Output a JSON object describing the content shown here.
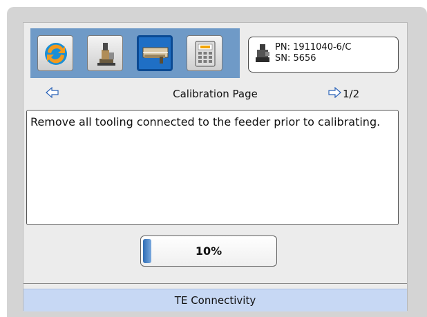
{
  "toolbar": {
    "buttons": [
      {
        "name": "refresh-icon",
        "active": false
      },
      {
        "name": "feeder-machine-icon",
        "active": false
      },
      {
        "name": "calibration-tool-icon",
        "active": true
      },
      {
        "name": "te-calculator-icon",
        "active": false
      }
    ]
  },
  "part_info": {
    "pn": "PN: 1911040-6/C",
    "sn": "SN: 5656",
    "icon": "applicator-icon"
  },
  "nav": {
    "prev_icon": "arrow-left-icon",
    "title": "Calibration Page",
    "next_icon": "arrow-right-icon",
    "page": "1/2"
  },
  "message": {
    "text": "Remove all tooling connected to the feeder prior to calibrating."
  },
  "progress": {
    "label": "10%",
    "fraction": 0.1
  },
  "footer": {
    "text": "TE Connectivity"
  },
  "colors": {
    "toolbar_bg": "#6f9ac7",
    "active_button": "#1f6fc5",
    "footer_bg": "#c7d8f4",
    "progress_fill": "#2f6db5"
  }
}
